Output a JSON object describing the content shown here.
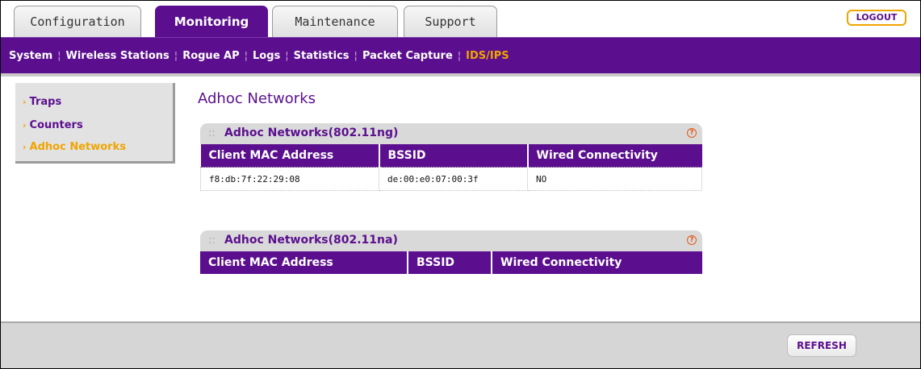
{
  "tabs": [
    {
      "label": "Configuration"
    },
    {
      "label": "Monitoring"
    },
    {
      "label": "Maintenance"
    },
    {
      "label": "Support"
    }
  ],
  "active_tab": "Monitoring",
  "logout_label": "LOGOUT",
  "subnav": [
    {
      "label": "System"
    },
    {
      "label": "Wireless Stations"
    },
    {
      "label": "Rogue AP"
    },
    {
      "label": "Logs"
    },
    {
      "label": "Statistics"
    },
    {
      "label": "Packet Capture"
    },
    {
      "label": "IDS/IPS"
    }
  ],
  "active_subnav": "IDS/IPS",
  "sidebar": {
    "items": [
      {
        "label": "Traps"
      },
      {
        "label": "Counters"
      },
      {
        "label": "Adhoc Networks"
      }
    ],
    "active": "Adhoc Networks"
  },
  "page_title": "Adhoc Networks",
  "panels": [
    {
      "title": "Adhoc Networks(802.11ng)",
      "columns": [
        "Client MAC Address",
        "BSSID",
        "Wired Connectivity"
      ],
      "rows": [
        [
          "f8:db:7f:22:29:08",
          "de:00:e0:07:00:3f",
          "NO"
        ]
      ]
    },
    {
      "title": "Adhoc Networks(802.11na)",
      "columns": [
        "Client MAC Address",
        "BSSID",
        "Wired Connectivity"
      ],
      "rows": []
    }
  ],
  "help_glyph": "?",
  "refresh_label": "REFRESH",
  "colors": {
    "brand_purple": "#5b0f8e",
    "accent_orange": "#f0a500",
    "help_orange": "#e25a1c"
  },
  "icons": {
    "menu_arrow": "chevron-right-icon",
    "panel_grip": "drag-grip-icon",
    "help": "help-icon"
  }
}
